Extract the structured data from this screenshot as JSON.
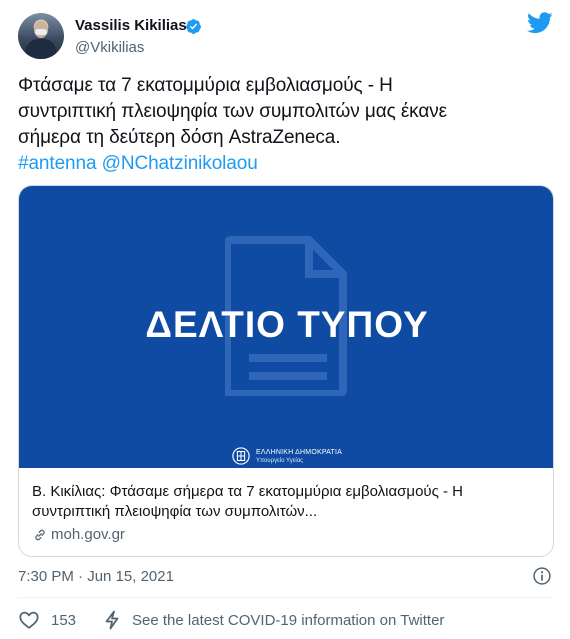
{
  "author": {
    "name": "Vassilis Kikilias",
    "handle": "@Vkikilias",
    "verified": true
  },
  "tweet": {
    "text_lines": [
      "Φτάσαμε τα 7 εκατομμύρια εμβολιασμούς - Η",
      "συντριπτική πλειοψηφία των συμπολιτών μας έκανε",
      "σήμερα τη δεύτερη δόση AstraZeneca."
    ],
    "hashtag": "#antenna",
    "mention": "@NChatzinikolaou",
    "timestamp": "7:30 PM · Jun 15, 2021"
  },
  "card": {
    "image_title": "ΔΕΛΤΙΟ ΤΥΠΟΥ",
    "gov_name": "ΕΛΛΗΝΙΚΗ ΔΗΜΟΚΡΑΤΙΑ",
    "gov_ministry": "Υπουργείο Υγείας",
    "text_lines": [
      "Β. Κικίλιας: Φτάσαμε σήμερα τα 7 εκατομμύρια εμβολιασμούς - Η",
      "συντριπτική πλειοψηφία των συμπολιτών..."
    ],
    "domain": "moh.gov.gr"
  },
  "actions": {
    "like_count": "153",
    "covid_text": "See the latest COVID-19 information on Twitter"
  },
  "colors": {
    "twitter_blue": "#1d9bf0",
    "card_background": "#0f4ba3",
    "secondary_text": "#536471"
  },
  "icons": [
    "twitter-bird-icon",
    "verified-badge-icon",
    "document-icon",
    "greek-emblem-icon",
    "link-icon",
    "info-icon",
    "heart-icon",
    "lightning-icon"
  ]
}
